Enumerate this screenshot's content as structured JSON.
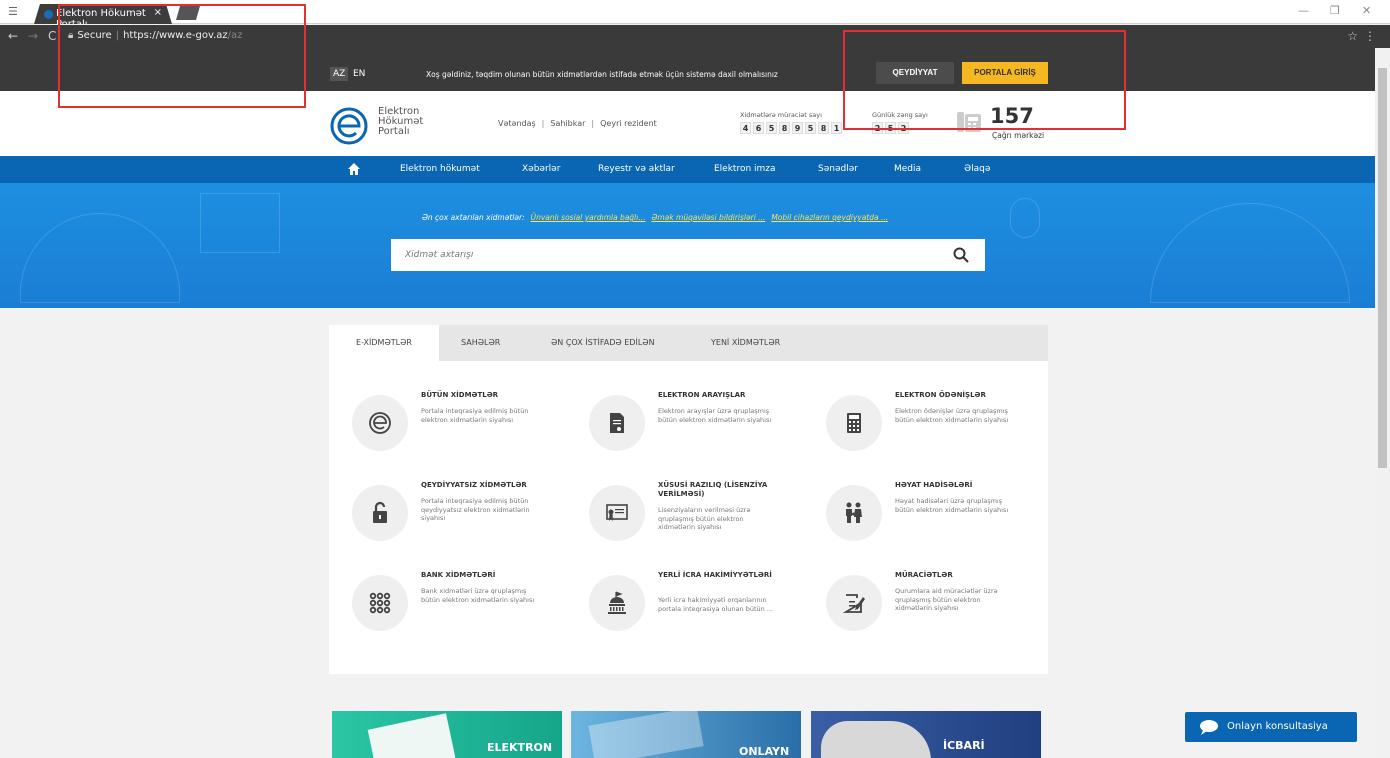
{
  "browser": {
    "tab_title": "Elektron Hökumət Portalı",
    "tab_close": "×",
    "secure_label": "Secure",
    "url_host": "https://www.e-gov.az",
    "url_path": "/az",
    "win_minimize": "—",
    "win_maximize": "❐",
    "win_close": "✕",
    "back": "←",
    "forward": "→",
    "reload": "C",
    "star": "☆",
    "menu": "⋮"
  },
  "topbar": {
    "lang_az": "AZ",
    "lang_en": "EN",
    "welcome": "Xoş gəldiniz, təqdim olunan bütün xidmətlərdən istifadə etmək üçün sistemə daxil olmalısınız",
    "register": "QEYDİYYAT",
    "login": "PORTALA GİRİŞ"
  },
  "header": {
    "logo_line1": "Elektron",
    "logo_line2": "Hökumət",
    "logo_line3": "Portalı",
    "user_citizen": "Vətəndaş",
    "user_business": "Sahibkar",
    "user_nonresident": "Qeyri rezident",
    "requests_label": "Xidmətlərə müraciət sayı",
    "requests_digits": [
      "4",
      "6",
      "5",
      "8",
      "9",
      "5",
      "8",
      "1"
    ],
    "daily_calls_label": "Günlük zəng sayı",
    "daily_calls_digits": [
      "2",
      "5",
      "2"
    ],
    "call_number": "157",
    "call_center": "Çağrı mərkəzi"
  },
  "nav": {
    "items": [
      "Elektron hökumət",
      "Xəbərlər",
      "Reyestr və aktlar",
      "Elektron imza",
      "Sənədlər",
      "Media",
      "Əlaqə"
    ]
  },
  "hero": {
    "popular_label": "Ən çox axtarılan xidmətlər:",
    "popular_links": [
      "Ünvanlı sosial yardımla bağlı...",
      "Əmək müqaviləsi bildirişləri ...",
      "Mobil cihazların qeydiyyatda ..."
    ],
    "search_placeholder": "Xidmət axtarışı"
  },
  "panel": {
    "tabs": [
      "E-XİDMƏTLƏR",
      "SAHƏLƏR",
      "ƏN ÇOX İSTİFADƏ EDİLƏN",
      "YENİ XİDMƏTLƏR"
    ],
    "services": [
      {
        "title": "BÜTÜN XİDMƏTLƏR",
        "desc": "Portala inteqrasiya edilmiş bütün elektron xidmətlərin siyahısı",
        "icon": "e-gov-logo-icon"
      },
      {
        "title": "ELEKTRON ARAYIŞLAR",
        "desc": "Elektron arayışlar üzrə qruplaşmış bütün elektron xidmətlərin siyahısı",
        "icon": "document-icon"
      },
      {
        "title": "ELEKTRON ÖDƏNİŞLƏR",
        "desc": "Elektron ödənişlər üzrə qruplaşmış bütün elektron xidmətlərin siyahısı",
        "icon": "calculator-icon"
      },
      {
        "title": "QEYDİYYATSIZ XİDMƏTLƏR",
        "desc": "Portala inteqrasiya edilmiş bütün qeydiyyatsız elektron xidmətlərin siyahısı",
        "icon": "unlock-icon"
      },
      {
        "title": "XÜSUSİ RAZILIQ (LİSENZİYA VERİLMƏSİ)",
        "desc": "Lisenziyaların verilməsi üzrə qruplaşmış bütün elektron xidmətlərin siyahısı",
        "icon": "certificate-icon"
      },
      {
        "title": "HƏYAT HADİSƏLƏRİ",
        "desc": "Həyat hadisələri üzrə qruplaşmış bütün elektron xidmətlərin siyahısı",
        "icon": "family-icon"
      },
      {
        "title": "BANK XİDMƏTLƏRİ",
        "desc": "Bank xidmətləri üzrə qruplaşmış bütün elektron xidmətlərin siyahısı",
        "icon": "grid-dots-icon"
      },
      {
        "title": "YERLİ İCRA HAKİMİYYƏTLƏRİ",
        "desc": "Yerli icra hakimiyyəti orqanlarının portala inteqrasiya olunan bütün ...",
        "icon": "government-building-icon"
      },
      {
        "title": "MÜRACİƏTLƏR",
        "desc": "Qurumlara aid müraciətlər üzrə qruplaşmış bütün elektron xidmətlərin siyahısı",
        "icon": "edit-note-icon"
      }
    ]
  },
  "banners": [
    "ELEKTRON",
    "ONLAYN",
    "İCBARİ"
  ],
  "chat": {
    "label": "Onlayn konsultasiya"
  },
  "colors": {
    "nav_blue": "#0a66b3",
    "login_yellow": "#f5b820",
    "topbar_dark": "#3a3a3a",
    "annotation_red": "#e0302f"
  }
}
